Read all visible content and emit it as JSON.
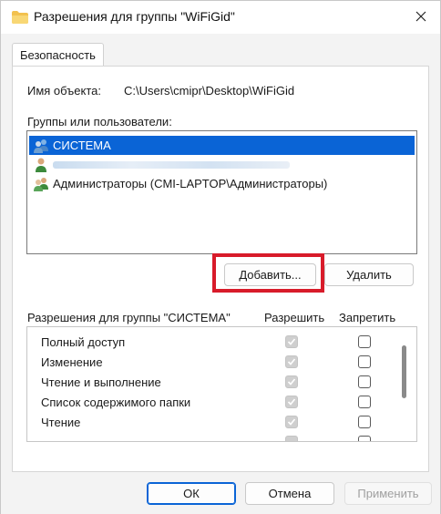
{
  "window": {
    "title": "Разрешения для группы \"WiFiGid\"",
    "icons": {
      "app": "folder-icon",
      "close": "close-icon"
    }
  },
  "tabs": [
    {
      "label": "Безопасность",
      "active": true
    }
  ],
  "object": {
    "name_label": "Имя объекта:",
    "path": "C:\\Users\\cmipr\\Desktop\\WiFiGid"
  },
  "groups": {
    "label": "Группы или пользователи:",
    "items": [
      {
        "label": "СИСТЕМА",
        "icon": "user-group-icon",
        "selected": true
      },
      {
        "label": "",
        "icon": "user-icon",
        "blurred": true
      },
      {
        "label": "Администраторы (CMI-LAPTOP\\Администраторы)",
        "icon": "user-group-icon",
        "selected": false
      }
    ],
    "add_button": "Добавить...",
    "remove_button": "Удалить"
  },
  "permissions": {
    "header": "Разрешения для группы \"СИСТЕМА\"",
    "allow_col": "Разрешить",
    "deny_col": "Запретить",
    "rows": [
      {
        "name": "Полный доступ",
        "allow": true,
        "deny": false
      },
      {
        "name": "Изменение",
        "allow": true,
        "deny": false
      },
      {
        "name": "Чтение и выполнение",
        "allow": true,
        "deny": false
      },
      {
        "name": "Список содержимого папки",
        "allow": true,
        "deny": false
      },
      {
        "name": "Чтение",
        "allow": true,
        "deny": false
      }
    ]
  },
  "footer": {
    "ok": "ОК",
    "cancel": "Отмена",
    "apply": "Применить"
  },
  "colors": {
    "selection": "#0a64d6",
    "highlight": "#d81b2a"
  }
}
